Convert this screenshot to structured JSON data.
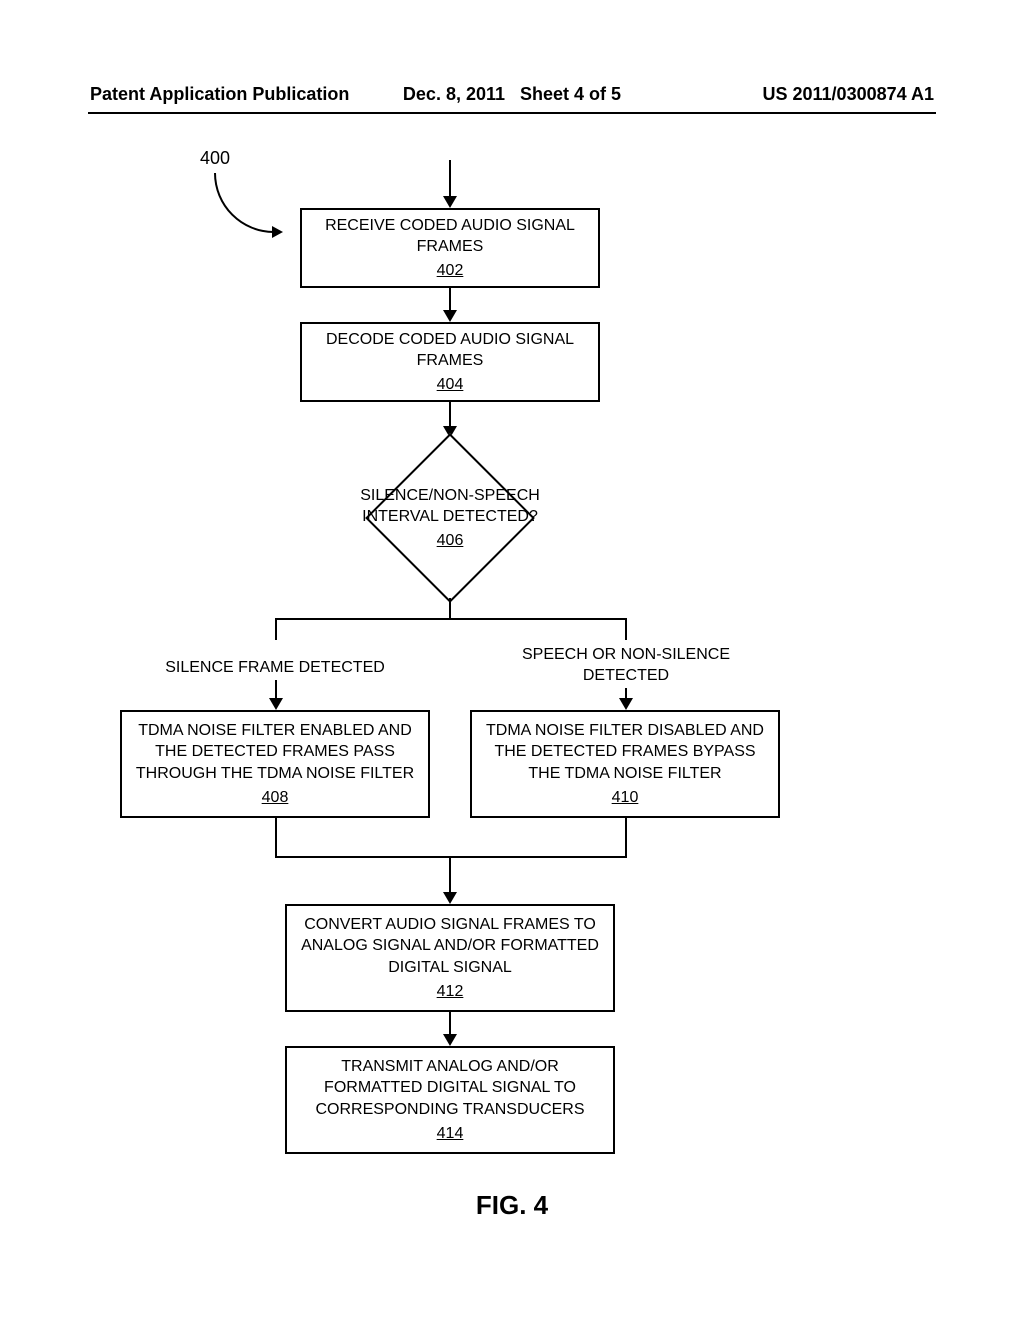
{
  "header": {
    "left": "Patent Application Publication",
    "date": "Dec. 8, 2011",
    "sheet": "Sheet 4 of 5",
    "pubnum": "US 2011/0300874 A1"
  },
  "flow": {
    "ref": "400",
    "b402": {
      "text": "RECEIVE CODED AUDIO SIGNAL FRAMES",
      "num": "402"
    },
    "b404": {
      "text": "DECODE CODED AUDIO SIGNAL FRAMES",
      "num": "404"
    },
    "d406": {
      "text": "SILENCE/NON-SPEECH INTERVAL DETECTED?",
      "num": "406"
    },
    "branch_left": "SILENCE FRAME DETECTED",
    "branch_right": "SPEECH OR NON-SILENCE DETECTED",
    "b408": {
      "text": "TDMA NOISE FILTER ENABLED AND THE DETECTED FRAMES PASS THROUGH THE TDMA NOISE FILTER",
      "num": "408"
    },
    "b410": {
      "text": "TDMA NOISE FILTER DISABLED AND THE DETECTED FRAMES BYPASS THE TDMA NOISE FILTER",
      "num": "410"
    },
    "b412": {
      "text": "CONVERT AUDIO SIGNAL FRAMES TO ANALOG SIGNAL AND/OR FORMATTED DIGITAL SIGNAL",
      "num": "412"
    },
    "b414": {
      "text": "TRANSMIT ANALOG AND/OR FORMATTED DIGITAL SIGNAL TO CORRESPONDING TRANSDUCERS",
      "num": "414"
    }
  },
  "caption": "FIG. 4"
}
